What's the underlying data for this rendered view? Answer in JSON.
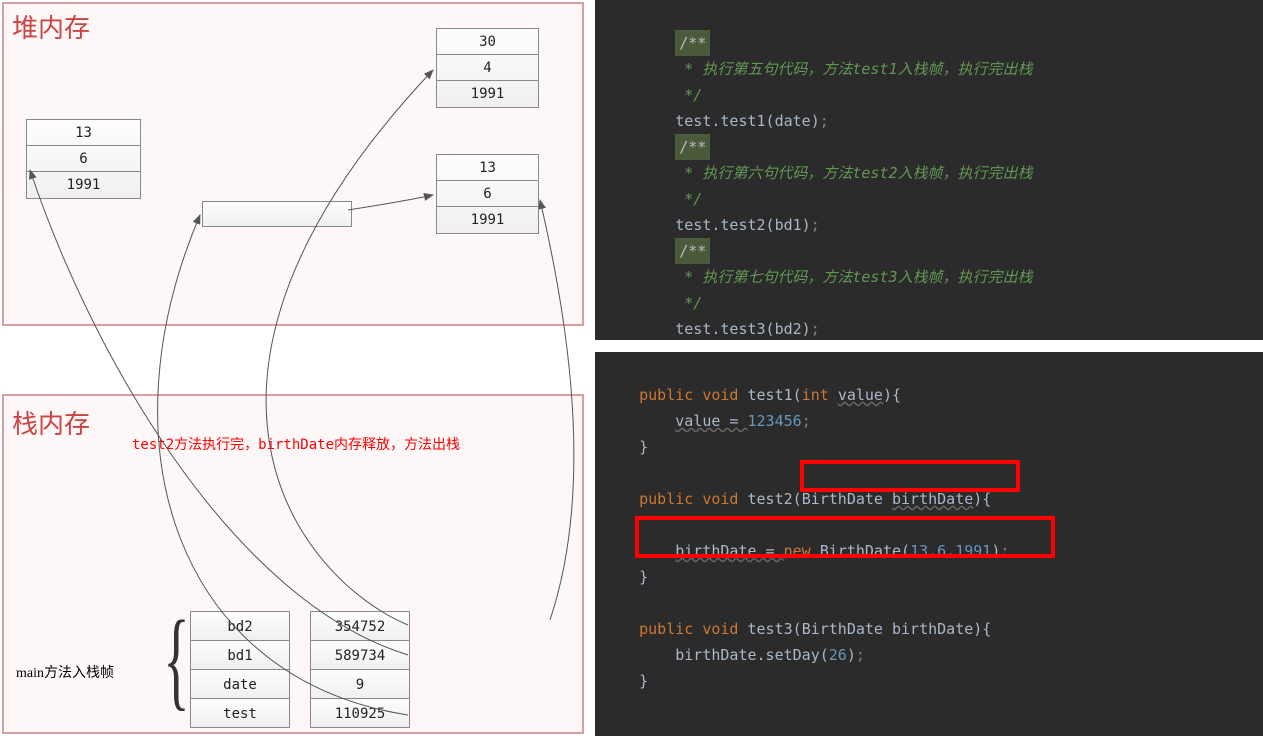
{
  "heap": {
    "title": "堆内存",
    "obj1": {
      "v1": "13",
      "v2": "6",
      "v3": "1991"
    },
    "obj2": {
      "v1": "30",
      "v2": "4",
      "v3": "1991"
    },
    "obj3": {
      "v1": "13",
      "v2": "6",
      "v3": "1991"
    },
    "obj4": {
      "v1": ""
    }
  },
  "stack": {
    "title": "栈内存",
    "note": "test2方法执行完，birthDate内存释放，方法出栈",
    "main_label": "main方法入栈帧",
    "vars": [
      {
        "name": "bd2",
        "addr": "354752"
      },
      {
        "name": "bd1",
        "addr": "589734"
      },
      {
        "name": "date",
        "addr": "9"
      },
      {
        "name": "test",
        "addr": "110925"
      }
    ]
  },
  "code1": {
    "c1a": " * 执行第五句代码，方法",
    "c1b": "test1",
    "c1c": "入栈帧，执行完出栈",
    "c1end": " */",
    "l1": "test.test1(date)",
    "c2a": " * 执行第六句代码，方法",
    "c2b": "test2",
    "c2c": "入栈帧，执行完出栈",
    "l2": "test.test2(bd1)",
    "c3a": " * 执行第七句代码，方法",
    "c3b": "test3",
    "c3c": "入栈帧，执行完出栈",
    "l3": "test.test3(bd2)",
    "doc": "/**"
  },
  "code2": {
    "pub": "public",
    "void": "void",
    "int": "int",
    "new": "new",
    "m1": "test1",
    "m1p": "value",
    "m1b": "value = ",
    "m1v": "123456",
    "m2": "test2",
    "m2pt": "BirthDate",
    "m2pn": "birthDate",
    "m2b1": "birthDate = ",
    "m2b2": "BirthDate(",
    "m2v1": "13",
    "m2v2": "6",
    "m2v3": "1991",
    "m3": "test3",
    "m3pt": "BirthDate",
    "m3pn": "birthDate",
    "m3b": "birthDate.setDay(",
    "m3v": "26"
  }
}
